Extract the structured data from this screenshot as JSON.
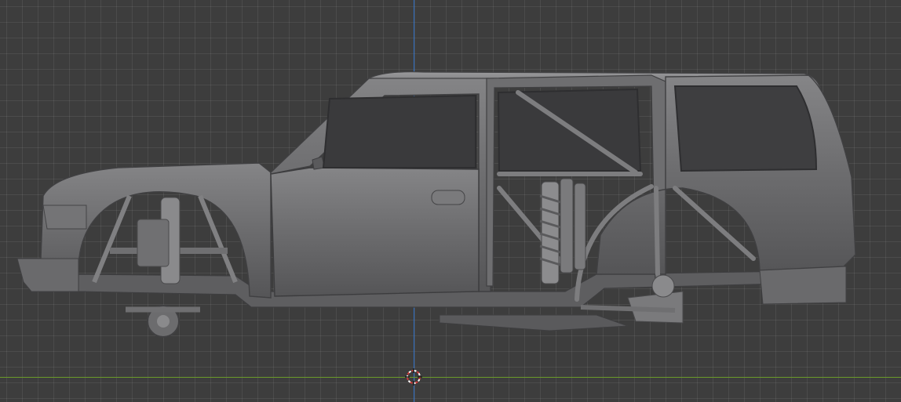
{
  "viewport": {
    "mode": "orthographic-side-view",
    "grid": true
  },
  "axes": {
    "vertical_axis_color": "#2f6fc4",
    "horizontal_axis_color": "#6b9a2a"
  },
  "cursor_3d": {
    "icon": "3d-cursor-icon",
    "ring_color_a": "#d33a3a",
    "ring_color_b": "#ffffff"
  },
  "model": {
    "name_icon": "suv-body-shell-icon",
    "body_color": "#6e6e70",
    "highlight_color": "#8a8a8c",
    "shadow_color": "#4c4c4e"
  }
}
